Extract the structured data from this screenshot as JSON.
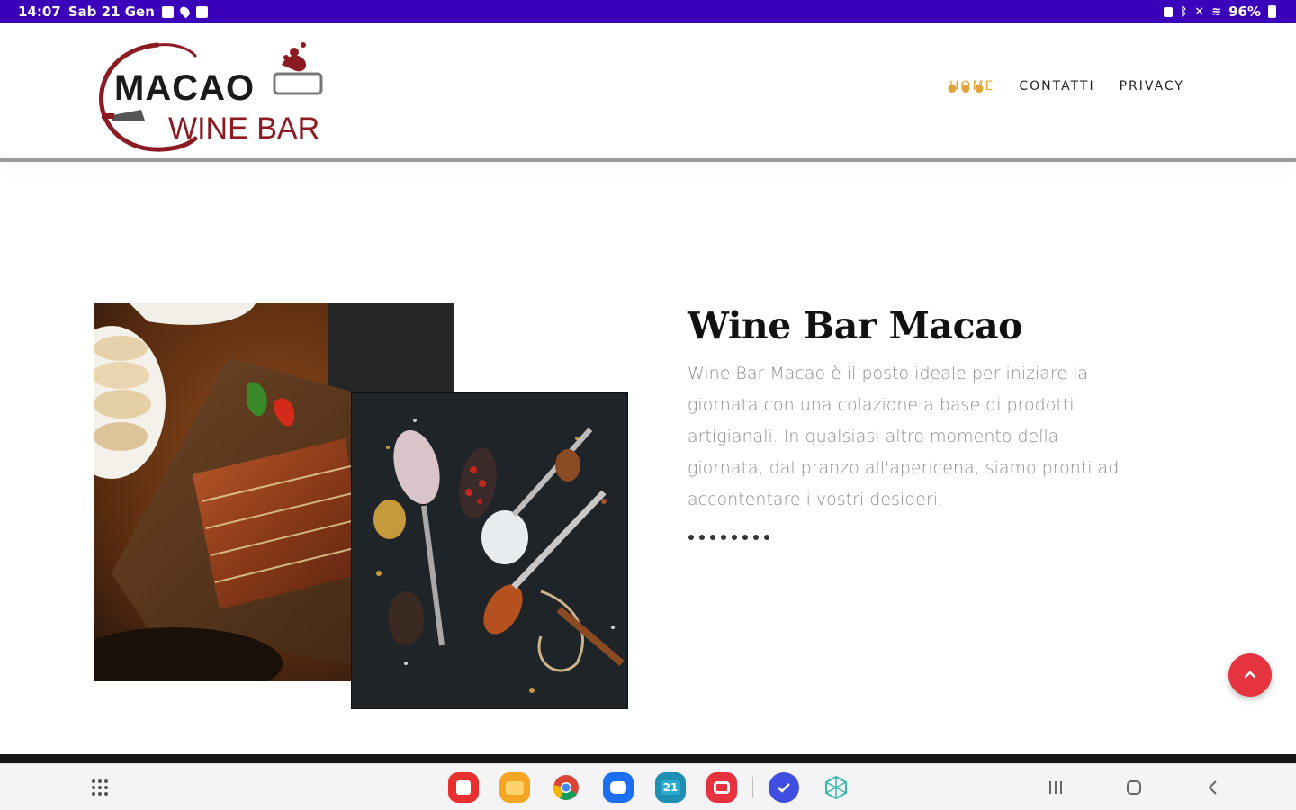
{
  "status_bar": {
    "time": "14:07",
    "date": "Sab 21 Gen",
    "battery": "96%"
  },
  "brand": {
    "line1": "MACAO",
    "line2": "WINE BAR",
    "accent_color": "#8b1a22"
  },
  "nav": {
    "items": [
      {
        "label": "HOME",
        "active": true
      },
      {
        "label": "CONTATTI",
        "active": false
      },
      {
        "label": "PRIVACY",
        "active": false
      }
    ],
    "active_color": "#e7a43b"
  },
  "hero": {
    "title": "Wine Bar Macao",
    "description": "Wine Bar Macao è il posto ideale per iniziare la giornata con una colazione a base di prodotti artigianali. In qualsiasi altro momento della giornata, dal pranzo all'apericena, siamo pronti ad accontentare i vostri desideri."
  },
  "scroll_top": {
    "color": "#e53440",
    "icon": "chevron-up-icon"
  },
  "taskbar": {
    "apps": [
      {
        "name": "app-drawer-icon"
      },
      {
        "name": "notes-app-icon",
        "color": "#e8312f"
      },
      {
        "name": "files-app-icon",
        "color": "#f6a623"
      },
      {
        "name": "chrome-app-icon"
      },
      {
        "name": "messages-app-icon",
        "color": "#1d6ff2"
      },
      {
        "name": "calendar-app-icon",
        "color": "#1f8fb3",
        "label": "21"
      },
      {
        "name": "screen-recorder-app-icon",
        "color": "#e8313f"
      },
      {
        "name": "tasks-app-icon",
        "color": "#3f4ee0"
      },
      {
        "name": "network-app-icon",
        "color": "#3bb6a8"
      }
    ]
  }
}
